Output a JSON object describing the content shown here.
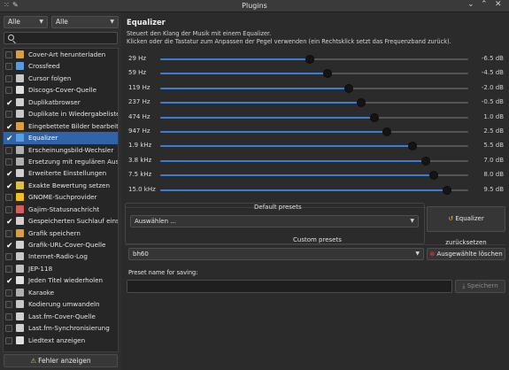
{
  "window": {
    "title": "Plugins"
  },
  "filters": {
    "filter_a": "Alle",
    "filter_b": "Alle"
  },
  "plugins": [
    {
      "label": "Cover-Art herunterladen",
      "checked": false,
      "icon": "cover-download-icon"
    },
    {
      "label": "Crossfeed",
      "checked": false,
      "icon": "speaker-icon"
    },
    {
      "label": "Cursor folgen",
      "checked": false,
      "icon": "cursor-icon"
    },
    {
      "label": "Discogs-Cover-Quelle",
      "checked": false,
      "icon": "cover-source-icon"
    },
    {
      "label": "Duplikatbrowser",
      "checked": true,
      "icon": "duplicate-icon"
    },
    {
      "label": "Duplikate in Wiedergabelisten en...",
      "checked": false,
      "icon": "playlist-icon"
    },
    {
      "label": "Eingebettete Bilder bearbeiten",
      "checked": true,
      "icon": "image-edit-icon"
    },
    {
      "label": "Equalizer",
      "checked": true,
      "icon": "equalizer-icon",
      "selected": true
    },
    {
      "label": "Erscheinungsbild-Wechsler",
      "checked": false,
      "icon": "appearance-icon"
    },
    {
      "label": "Ersetzung mit regulären Ausdrüc...",
      "checked": false,
      "icon": "regex-icon"
    },
    {
      "label": "Erweiterte Einstellungen",
      "checked": true,
      "icon": "advanced-settings-icon"
    },
    {
      "label": "Exakte Bewertung setzen",
      "checked": true,
      "icon": "rating-icon"
    },
    {
      "label": "GNOME-Suchprovider",
      "checked": false,
      "icon": "gnome-search-icon"
    },
    {
      "label": "Gajim-Statusnachricht",
      "checked": false,
      "icon": "gajim-icon"
    },
    {
      "label": "Gespeicherten Suchlauf einschlie...",
      "checked": true,
      "icon": "saved-search-icon"
    },
    {
      "label": "Grafik speichern",
      "checked": false,
      "icon": "save-image-icon"
    },
    {
      "label": "Grafik-URL-Cover-Quelle",
      "checked": true,
      "icon": "image-url-icon"
    },
    {
      "label": "Internet-Radio-Log",
      "checked": false,
      "icon": "radio-log-icon"
    },
    {
      "label": "JEP-118",
      "checked": false,
      "icon": "jep-icon"
    },
    {
      "label": "Jeden Titel wiederholen",
      "checked": true,
      "icon": "repeat-icon"
    },
    {
      "label": "Karaoke",
      "checked": false,
      "icon": "karaoke-icon"
    },
    {
      "label": "Kodierung umwandeln",
      "checked": false,
      "icon": "encoding-icon"
    },
    {
      "label": "Last.fm-Cover-Quelle",
      "checked": false,
      "icon": "lastfm-cover-icon"
    },
    {
      "label": "Last.fm-Synchronisierung",
      "checked": false,
      "icon": "lastfm-sync-icon"
    },
    {
      "label": "Liedtext anzeigen",
      "checked": false,
      "icon": "lyrics-icon"
    }
  ],
  "error_button": "Fehler anzeigen",
  "equalizer": {
    "title": "Equalizer",
    "desc_line1": "Steuert den Klang der Musik mit einem Equalizer.",
    "desc_line2": "Klicken oder die Tastatur zum Anpassen der Pegel verwenden (ein Rechtsklick setzt das Frequenzband zurück).",
    "gain_min": -24,
    "gain_max": 12,
    "bands": [
      {
        "freq": "29   Hz",
        "gain": "-6.5 dB",
        "value": -6.5
      },
      {
        "freq": "59   Hz",
        "gain": "-4.5 dB",
        "value": -4.5
      },
      {
        "freq": "119  Hz",
        "gain": "-2.0 dB",
        "value": -2.0
      },
      {
        "freq": "237  Hz",
        "gain": "-0.5 dB",
        "value": -0.5
      },
      {
        "freq": "474  Hz",
        "gain": "1.0 dB",
        "value": 1.0
      },
      {
        "freq": "947  Hz",
        "gain": "2.5 dB",
        "value": 2.5
      },
      {
        "freq": "1.9 kHz",
        "gain": "5.5 dB",
        "value": 5.5
      },
      {
        "freq": "3.8 kHz",
        "gain": "7.0 dB",
        "value": 7.0
      },
      {
        "freq": "7.5 kHz",
        "gain": "8.0 dB",
        "value": 8.0
      },
      {
        "freq": "15.0 kHz",
        "gain": "9.5 dB",
        "value": 9.5
      }
    ]
  },
  "default_presets": {
    "label": "Default presets",
    "selected": "Auswählen ...",
    "reset_button": "Equalizer zurücksetzen"
  },
  "custom_presets": {
    "label": "Custom presets",
    "selected": "bh60",
    "delete_button": "Ausgewählte löschen",
    "name_label": "Preset name for saving:",
    "name_value": "",
    "save_button": "Speichern"
  }
}
